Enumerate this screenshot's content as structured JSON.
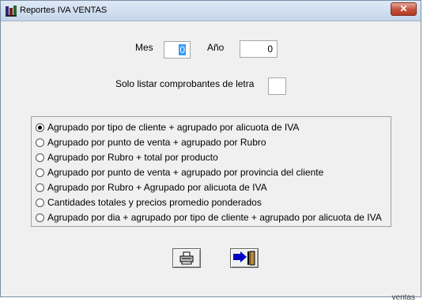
{
  "window": {
    "title": "Reportes IVA VENTAS",
    "close_label": "✕"
  },
  "form": {
    "mes_label": "Mes",
    "mes_value": "0",
    "anio_label": "Año",
    "anio_value": "0",
    "letra_label": "Solo listar comprobantes de letra",
    "letra_value": ""
  },
  "options": [
    {
      "label": "Agrupado por tipo de cliente + agrupado por alicuota de IVA",
      "selected": true
    },
    {
      "label": "Agrupado por punto de venta + agrupado por Rubro",
      "selected": false
    },
    {
      "label": "Agrupado por Rubro + total por producto",
      "selected": false
    },
    {
      "label": "Agrupado por punto de venta + agrupado por provincia del cliente",
      "selected": false
    },
    {
      "label": "Agrupado por Rubro + Agrupado por alicuota de IVA",
      "selected": false
    },
    {
      "label": "Cantidades totales y precios promedio ponderados",
      "selected": false
    },
    {
      "label": "Agrupado por dia + agrupado por tipo de cliente + agrupado por alicuota de IVA",
      "selected": false
    }
  ],
  "buttons": {
    "print_icon": "printer-icon",
    "exit_icon": "exit-door-icon"
  },
  "background": {
    "partial_text": "ventas"
  }
}
